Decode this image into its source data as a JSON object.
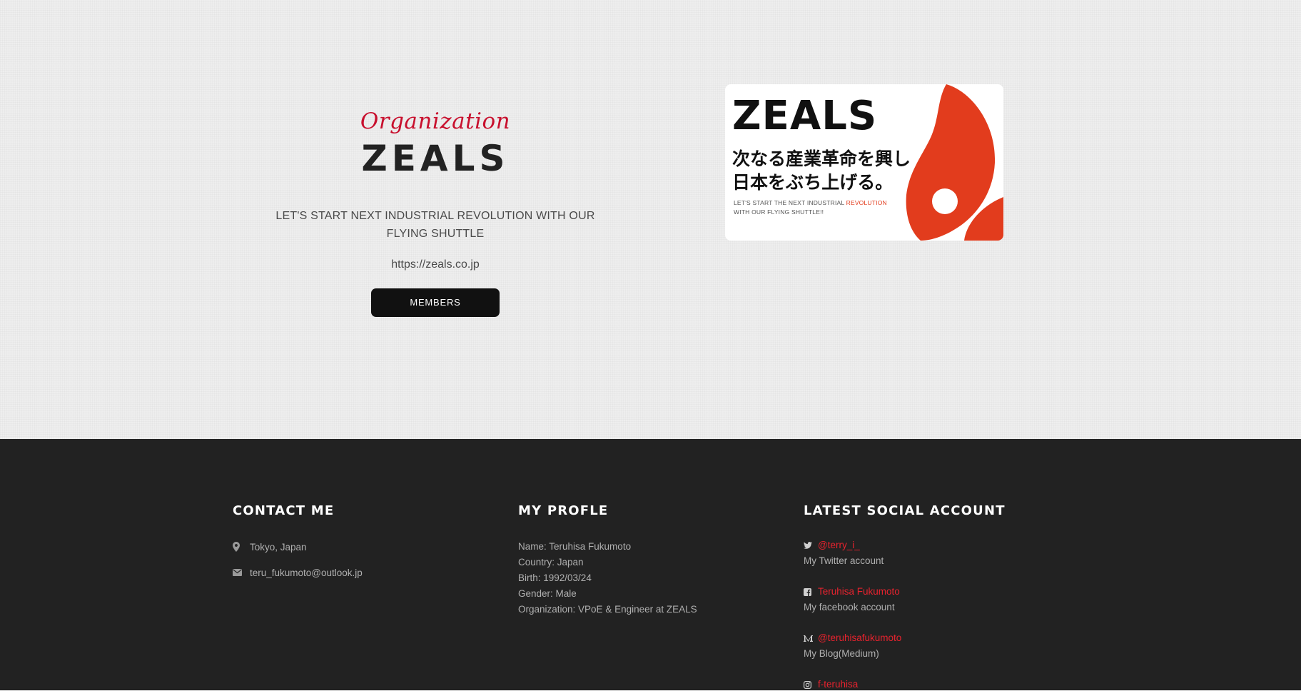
{
  "organization": {
    "kicker": "Organization",
    "name": "ZEALS",
    "tagline": "LET'S START NEXT INDUSTRIAL REVOLUTION WITH OUR FLYING SHUTTLE",
    "url": "https://zeals.co.jp",
    "members_button": "MEMBERS"
  },
  "banner": {
    "title": "ZEALS",
    "jp_line1": "次なる産業革命を興し",
    "jp_line2": "日本をぶち上げる。",
    "small_line1_pre": "LET'S START THE NEXT INDUSTRIAL ",
    "small_line1_accent": "REVOLUTION",
    "small_line2": "WITH OUR FLYING SHUTTLE!!",
    "accent_color": "#e23c1d"
  },
  "footer": {
    "contact": {
      "heading": "CONTACT ME",
      "location": "Tokyo, Japan",
      "email": "teru_fukumoto@outlook.jp",
      "location_icon": "map-marker-icon",
      "email_icon": "envelope-icon"
    },
    "profile": {
      "heading": "MY PROFLE",
      "lines": [
        "Name: Teruhisa Fukumoto",
        "Country: Japan",
        "Birth: 1992/03/24",
        "Gender: Male",
        "Organization: VPoE & Engineer at ZEALS"
      ]
    },
    "social": {
      "heading": "LATEST SOCIAL ACCOUNT",
      "items": [
        {
          "icon": "twitter-icon",
          "handle": "@terry_i_",
          "desc": "My Twitter account"
        },
        {
          "icon": "facebook-icon",
          "handle": "Teruhisa Fukumoto",
          "desc": "My facebook account"
        },
        {
          "icon": "medium-icon",
          "handle": "@teruhisafukumoto",
          "desc": "My Blog(Medium)"
        },
        {
          "icon": "instagram-icon",
          "handle": "f-teruhisa",
          "desc": ""
        }
      ],
      "link_color": "#e8222e"
    }
  },
  "colors": {
    "brand_red": "#c8102e",
    "footer_bg": "#222222",
    "button_bg": "#111111"
  }
}
